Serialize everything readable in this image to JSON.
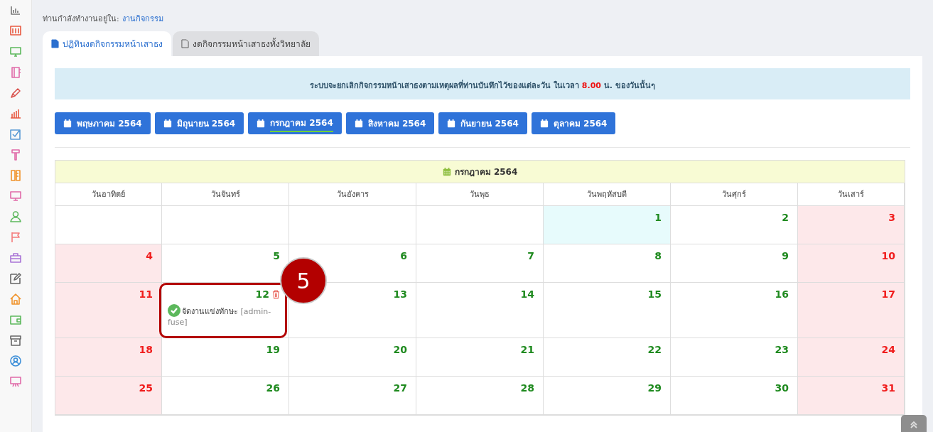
{
  "breadcrumb": {
    "label": "ท่านกำลังทำงานอยู่ใน:",
    "link": "งานกิจกรรม"
  },
  "tabs": [
    {
      "label": "ปฏิทินงดกิจกรรมหน้าเสาธง",
      "selected": true
    },
    {
      "label": "งดกิจกรรมหน้าเสาธงทั้งวิทยาลัย",
      "selected": false
    }
  ],
  "notice": "ระบบจะยกเลิกกิจกรรมหน้าเสาธงตามเหตุผลที่ท่านบันทึกไว้ของแต่ละวัน ในเวลา **8.00** น. ของวันนั้นๆ",
  "months": [
    {
      "label": "พฤษภาคม 2564",
      "selected": false
    },
    {
      "label": "มิถุนายน 2564",
      "selected": false
    },
    {
      "label": "กรกฎาคม 2564",
      "selected": true
    },
    {
      "label": "สิงหาคม 2564",
      "selected": false
    },
    {
      "label": "กันยายน 2564",
      "selected": false
    },
    {
      "label": "ตุลาคม 2564",
      "selected": false
    }
  ],
  "calendar": {
    "title": "กรกฎาคม 2564",
    "weekdays": [
      "วันอาทิตย์",
      "วันจันทร์",
      "วันอังคาร",
      "วันพุธ",
      "วันพฤหัสบดี",
      "วันศุกร์",
      "วันเสาร์"
    ],
    "weeks": [
      [
        {
          "kind": "empty"
        },
        {
          "kind": "empty"
        },
        {
          "kind": "empty"
        },
        {
          "kind": "empty"
        },
        {
          "kind": "today",
          "day": "1"
        },
        {
          "kind": "day",
          "day": "2"
        },
        {
          "kind": "weekend",
          "day": "3"
        }
      ],
      [
        {
          "kind": "weekend",
          "day": "4"
        },
        {
          "kind": "day",
          "day": "5"
        },
        {
          "kind": "day",
          "day": "6"
        },
        {
          "kind": "day",
          "day": "7"
        },
        {
          "kind": "day",
          "day": "8"
        },
        {
          "kind": "day",
          "day": "9"
        },
        {
          "kind": "weekend",
          "day": "10"
        }
      ],
      [
        {
          "kind": "weekend",
          "day": "11"
        },
        {
          "kind": "day",
          "day": "12",
          "annotation": "5",
          "events": [
            {
              "text": "จัดงานแข่งทักษะ",
              "author": "[admin-fuse]",
              "done": true
            }
          ]
        },
        {
          "kind": "day",
          "day": "13"
        },
        {
          "kind": "day",
          "day": "14"
        },
        {
          "kind": "day",
          "day": "15"
        },
        {
          "kind": "day",
          "day": "16"
        },
        {
          "kind": "weekend",
          "day": "17"
        }
      ],
      [
        {
          "kind": "weekend",
          "day": "18"
        },
        {
          "kind": "day",
          "day": "19"
        },
        {
          "kind": "day",
          "day": "20"
        },
        {
          "kind": "day",
          "day": "21"
        },
        {
          "kind": "day",
          "day": "22"
        },
        {
          "kind": "day",
          "day": "23"
        },
        {
          "kind": "weekend",
          "day": "24"
        }
      ],
      [
        {
          "kind": "weekend",
          "day": "25"
        },
        {
          "kind": "day",
          "day": "26"
        },
        {
          "kind": "day",
          "day": "27"
        },
        {
          "kind": "day",
          "day": "28"
        },
        {
          "kind": "day",
          "day": "29"
        },
        {
          "kind": "day",
          "day": "30"
        },
        {
          "kind": "weekend",
          "day": "31"
        }
      ]
    ]
  }
}
